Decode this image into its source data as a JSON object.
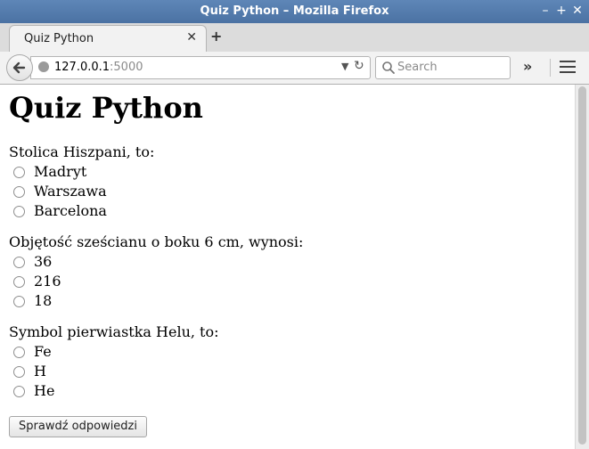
{
  "window": {
    "title": "Quiz Python – Mozilla Firefox"
  },
  "tab": {
    "label": "Quiz Python"
  },
  "address": {
    "host": "127.0.0.1",
    "port": ":5000"
  },
  "search": {
    "placeholder": "Search"
  },
  "page": {
    "title": "Quiz Python",
    "questions": [
      {
        "text": "Stolica Hiszpani, to:",
        "options": [
          "Madryt",
          "Warszawa",
          "Barcelona"
        ]
      },
      {
        "text": "Objętość sześcianu o boku 6 cm, wynosi:",
        "options": [
          "36",
          "216",
          "18"
        ]
      },
      {
        "text": "Symbol pierwiastka Helu, to:",
        "options": [
          "Fe",
          "H",
          "He"
        ]
      }
    ],
    "submit_label": "Sprawdź odpowiedzi"
  },
  "colors": {
    "titlebar": "#4b72a3",
    "toolbar": "#f2f2f2"
  },
  "icons": [
    "minimize-icon",
    "maximize-icon",
    "close-icon",
    "tab-close-icon",
    "new-tab-icon",
    "back-icon",
    "globe-icon",
    "dropdown-icon",
    "reload-icon",
    "search-icon",
    "overflow-icon",
    "hamburger-menu-icon"
  ]
}
